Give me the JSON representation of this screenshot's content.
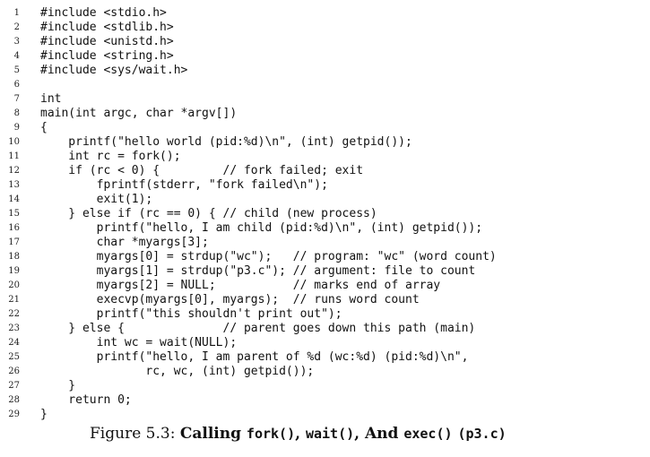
{
  "code_lines": [
    {
      "n": "1",
      "text": "#include <stdio.h>"
    },
    {
      "n": "2",
      "text": "#include <stdlib.h>"
    },
    {
      "n": "3",
      "text": "#include <unistd.h>"
    },
    {
      "n": "4",
      "text": "#include <string.h>"
    },
    {
      "n": "5",
      "text": "#include <sys/wait.h>"
    },
    {
      "n": "6",
      "text": ""
    },
    {
      "n": "7",
      "text": "int"
    },
    {
      "n": "8",
      "text": "main(int argc, char *argv[])"
    },
    {
      "n": "9",
      "text": "{"
    },
    {
      "n": "10",
      "text": "    printf(\"hello world (pid:%d)\\n\", (int) getpid());"
    },
    {
      "n": "11",
      "text": "    int rc = fork();"
    },
    {
      "n": "12",
      "text": "    if (rc < 0) {         // fork failed; exit"
    },
    {
      "n": "13",
      "text": "        fprintf(stderr, \"fork failed\\n\");"
    },
    {
      "n": "14",
      "text": "        exit(1);"
    },
    {
      "n": "15",
      "text": "    } else if (rc == 0) { // child (new process)"
    },
    {
      "n": "16",
      "text": "        printf(\"hello, I am child (pid:%d)\\n\", (int) getpid());"
    },
    {
      "n": "17",
      "text": "        char *myargs[3];"
    },
    {
      "n": "18",
      "text": "        myargs[0] = strdup(\"wc\");   // program: \"wc\" (word count)"
    },
    {
      "n": "19",
      "text": "        myargs[1] = strdup(\"p3.c\"); // argument: file to count"
    },
    {
      "n": "20",
      "text": "        myargs[2] = NULL;           // marks end of array"
    },
    {
      "n": "21",
      "text": "        execvp(myargs[0], myargs);  // runs word count"
    },
    {
      "n": "22",
      "text": "        printf(\"this shouldn't print out\");"
    },
    {
      "n": "23",
      "text": "    } else {              // parent goes down this path (main)"
    },
    {
      "n": "24",
      "text": "        int wc = wait(NULL);"
    },
    {
      "n": "25",
      "text": "        printf(\"hello, I am parent of %d (wc:%d) (pid:%d)\\n\","
    },
    {
      "n": "26",
      "text": "               rc, wc, (int) getpid());"
    },
    {
      "n": "27",
      "text": "    }"
    },
    {
      "n": "28",
      "text": "    return 0;"
    },
    {
      "n": "29",
      "text": "}"
    }
  ],
  "caption": {
    "prefix": "Figure 5.3: ",
    "calling": "Calling ",
    "fork": "fork()",
    "sep1": ", ",
    "wait": "wait()",
    "sep2": ", And ",
    "exec": "exec()",
    "space": " ",
    "file": "(p3.c)"
  }
}
